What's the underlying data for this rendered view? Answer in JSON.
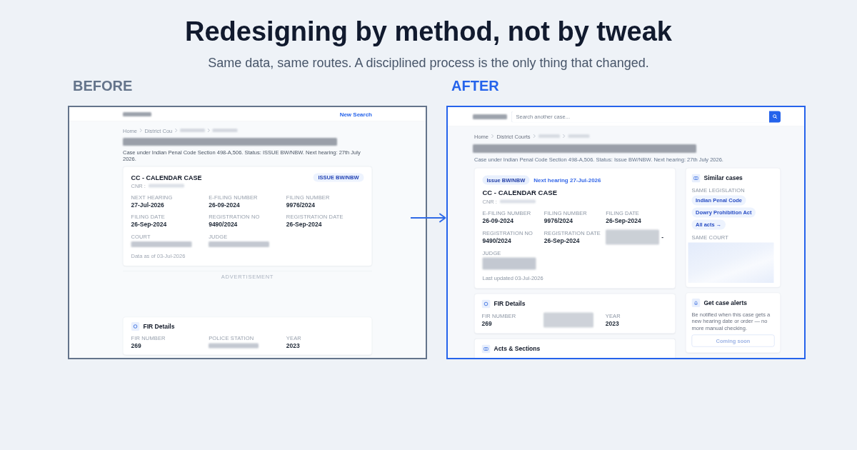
{
  "heading": {
    "title": "Redesigning by method, not by tweak",
    "subtitle": "Same data, same routes. A disciplined process is the only thing that changed."
  },
  "before": {
    "label": "BEFORE",
    "header": {
      "logo": {
        "kind": "redacted"
      },
      "link": "New Search"
    },
    "breadcrumb": [
      {
        "kind": "text",
        "text": "Home"
      },
      {
        "kind": "text",
        "text": "District Cou"
      },
      {
        "kind": "redacted"
      },
      {
        "kind": "redacted"
      }
    ],
    "page_title": {
      "kind": "redacted"
    },
    "summary": "Case under Indian Penal Code Section 498-A,506. Status: ISSUE BW/NBW. Next hearing: 27th July 2026.",
    "case_card": {
      "title": "CC - CALENDAR CASE",
      "badge": "ISSUE BW/NBW",
      "cnr": {
        "label": "CNR :",
        "kind": "redacted"
      },
      "fields": [
        {
          "kind": "text",
          "label": "NEXT HEARING",
          "value": "27-Jul-2026"
        },
        {
          "kind": "text",
          "label": "E-FILING NUMBER",
          "value": "26-09-2024"
        },
        {
          "kind": "text",
          "label": "FILING NUMBER",
          "value": "9976/2024"
        },
        {
          "kind": "text",
          "label": "FILING DATE",
          "value": "26-Sep-2024"
        },
        {
          "kind": "text",
          "label": "REGISTRATION NO",
          "value": "9490/2024"
        },
        {
          "kind": "text",
          "label": "REGISTRATION DATE",
          "value": "26-Sep-2024"
        },
        {
          "kind": "redacted",
          "label": "COURT"
        },
        {
          "kind": "redacted",
          "label": "JUDGE"
        }
      ],
      "footnote": "Data as of 03-Jul-2026"
    },
    "ad_label": "ADVERTISEMENT",
    "fir_card": {
      "title": "FIR Details",
      "fields": [
        {
          "kind": "text",
          "label": "FIR NUMBER",
          "value": "269"
        },
        {
          "kind": "redacted",
          "label": "POLICE STATION"
        },
        {
          "kind": "text",
          "label": "YEAR",
          "value": "2023"
        }
      ]
    }
  },
  "after": {
    "label": "AFTER",
    "header": {
      "logo": {
        "kind": "redacted"
      },
      "search_placeholder": "Search another case..."
    },
    "breadcrumb": [
      {
        "kind": "text",
        "text": "Home"
      },
      {
        "kind": "text",
        "text": "District Courts"
      },
      {
        "kind": "redacted"
      },
      {
        "kind": "redacted"
      }
    ],
    "page_title": {
      "kind": "redacted"
    },
    "summary": "Case under Indian Penal Code Section 498-A,506. Status: Issue BW/NBW. Next hearing: 27th July 2026.",
    "case_card": {
      "badge": "Issue BW/NBW",
      "next_hearing": "Next hearing 27-Jul-2026",
      "title": "CC - CALENDAR CASE",
      "cnr": {
        "label": "CNR :",
        "kind": "redacted"
      },
      "fields": [
        {
          "kind": "text",
          "label": "E-FILING NUMBER",
          "value": "26-09-2024"
        },
        {
          "kind": "text",
          "label": "FILING NUMBER",
          "value": "9976/2024"
        },
        {
          "kind": "text",
          "label": "FILING DATE",
          "value": "26-Sep-2024"
        },
        {
          "kind": "text",
          "label": "REGISTRATION NO",
          "value": "9490/2024"
        },
        {
          "kind": "text",
          "label": "REGISTRATION DATE",
          "value": "26-Sep-2024"
        },
        {
          "kind": "redacted_pair",
          "value": "-"
        },
        {
          "kind": "redacted",
          "label": "JUDGE"
        }
      ],
      "footnote": "Last updated 03-Jul-2026"
    },
    "fir_card": {
      "title": "FIR Details",
      "fields": [
        {
          "kind": "text",
          "label": "FIR NUMBER",
          "value": "269"
        },
        {
          "kind": "redacted_pair"
        },
        {
          "kind": "text",
          "label": "YEAR",
          "value": "2023"
        }
      ]
    },
    "acts_card": {
      "title": "Acts & Sections"
    },
    "similar_card": {
      "title": "Similar cases",
      "sections": [
        {
          "kind": "chips",
          "label": "SAME LEGISLATION",
          "chips": [
            "Indian Penal Code",
            "Dowry Prohibition Act",
            "All acts →"
          ]
        },
        {
          "kind": "redacted",
          "label": "SAME COURT"
        }
      ]
    },
    "alerts_card": {
      "title": "Get case alerts",
      "text": "Be notified when this case gets a new hearing date or order — no more manual checking.",
      "button": {
        "label": "Coming soon",
        "disabled": true
      }
    }
  }
}
